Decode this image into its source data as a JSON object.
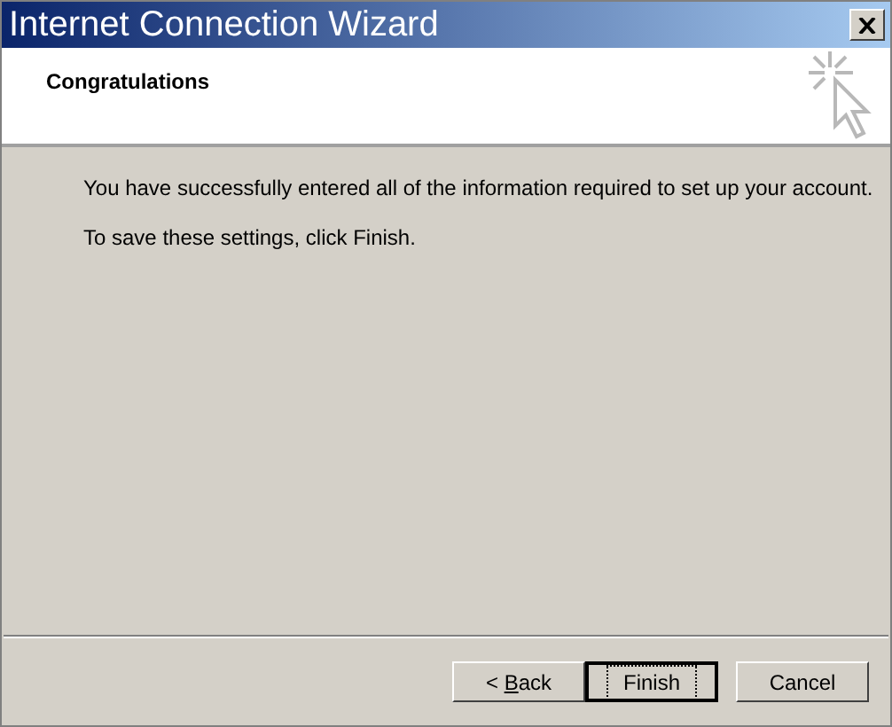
{
  "window": {
    "title": "Internet Connection Wizard"
  },
  "header": {
    "title": "Congratulations"
  },
  "body": {
    "paragraphs": [
      "You have successfully entered all of the information required to set up your account.",
      "To save these settings, click Finish."
    ]
  },
  "buttons": [
    {
      "label_before": "< ",
      "access_key": "B",
      "label_after": "ack",
      "default": false,
      "focused": false
    },
    {
      "label_before": "Finish",
      "default": true,
      "focused": true
    },
    {
      "label_before": "Cancel",
      "default": false,
      "focused": false
    }
  ]
}
